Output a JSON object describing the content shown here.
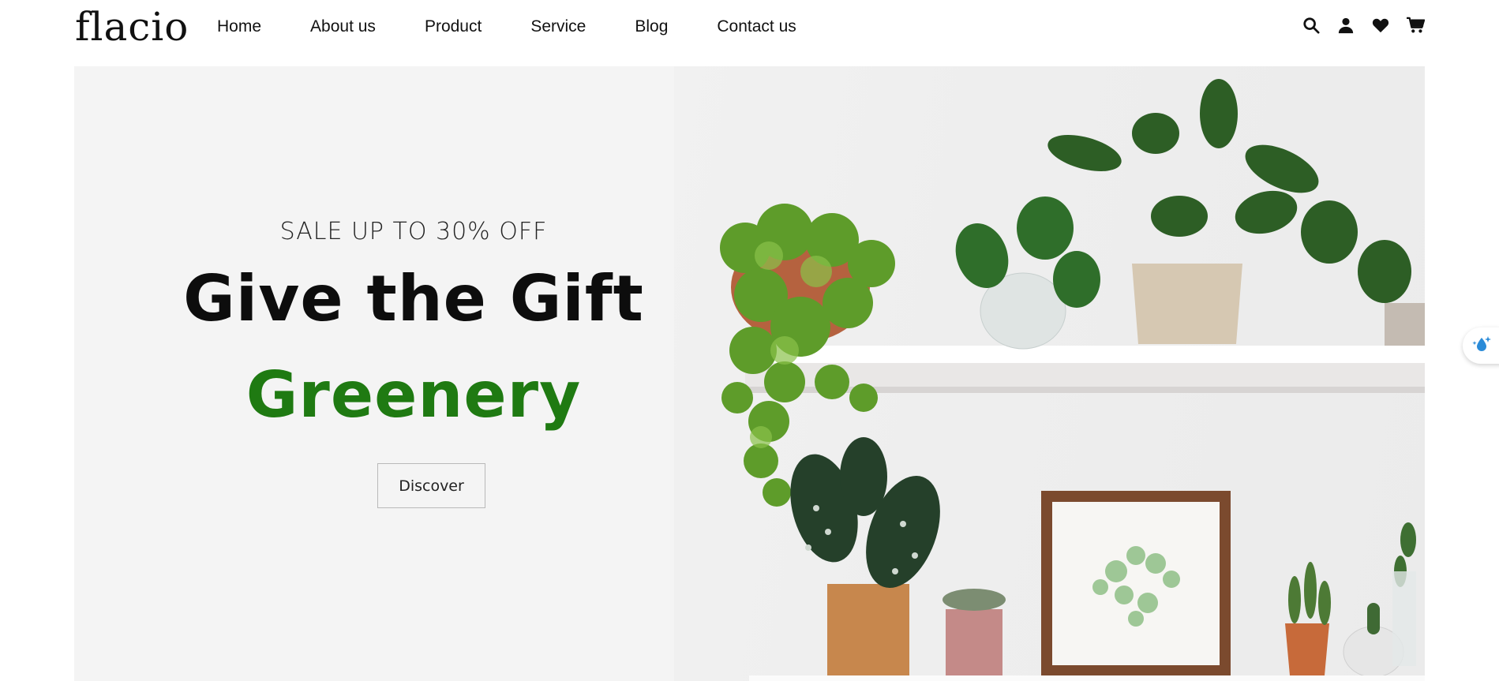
{
  "brand": {
    "logo_text": "flacio"
  },
  "nav": {
    "items": [
      {
        "label": "Home"
      },
      {
        "label": "About us"
      },
      {
        "label": "Product"
      },
      {
        "label": "Service"
      },
      {
        "label": "Blog"
      },
      {
        "label": "Contact us"
      }
    ]
  },
  "header_icons": [
    "search-icon",
    "user-icon",
    "heart-icon",
    "cart-icon"
  ],
  "hero": {
    "sale_text": "SALE UP TO 30% OFF",
    "headline": "Give the Gift",
    "headline_accent": "Greenery",
    "cta_label": "Discover"
  },
  "colors": {
    "accent_green": "#1f7a12",
    "text_dark": "#0d0d0d",
    "hero_bg": "#f4f4f4"
  },
  "floating_widget": {
    "icon": "water-drop-sparkle-icon"
  }
}
